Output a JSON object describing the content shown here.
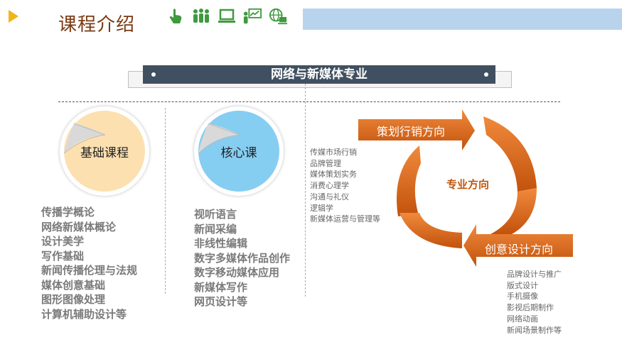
{
  "header": {
    "title": "课程介绍"
  },
  "icons": [
    "hand-pointer-icon",
    "people-group-icon",
    "laptop-icon",
    "presentation-icon",
    "globe-computer-icon"
  ],
  "program": {
    "title": "网络与新媒体专业"
  },
  "basic": {
    "label": "基础课程",
    "courses": [
      "传播学概论",
      "网络新媒体概论",
      "设计美学",
      "写作基础",
      "新闻传播伦理与法规",
      "媒体创意基础",
      "图形图像处理",
      "计算机辅助设计等"
    ]
  },
  "core": {
    "label": "核心课",
    "courses": [
      "视听语言",
      "新闻采编",
      "非线性编辑",
      "数字多媒体作品创作",
      "数字移动媒体应用",
      "新媒体写作",
      "网页设计等"
    ]
  },
  "direction": {
    "center": "专业方向",
    "marketing": {
      "label": "策划行销方向",
      "courses": [
        "传媒市场行销",
        "品牌管理",
        "媒体策划实务",
        "消费心理学",
        "沟通与礼仪",
        "逻辑学",
        "新媒体运营与管理等"
      ]
    },
    "design": {
      "label": "创意设计方向",
      "courses": [
        "品牌设计与推广",
        "版式设计",
        "手机摄像",
        "影视后期制作",
        "网络动画",
        "新闻场景制作等"
      ]
    }
  },
  "colors": {
    "accent_yellow": "#f0b41c",
    "title_brown": "#7a3a12",
    "band_blue": "#b7d4ec",
    "program_bar": "#415060",
    "orange": "#d86a1a",
    "peach": "#fde0b0",
    "sky": "#86cdf2",
    "icon_green": "#3f9a3f"
  }
}
